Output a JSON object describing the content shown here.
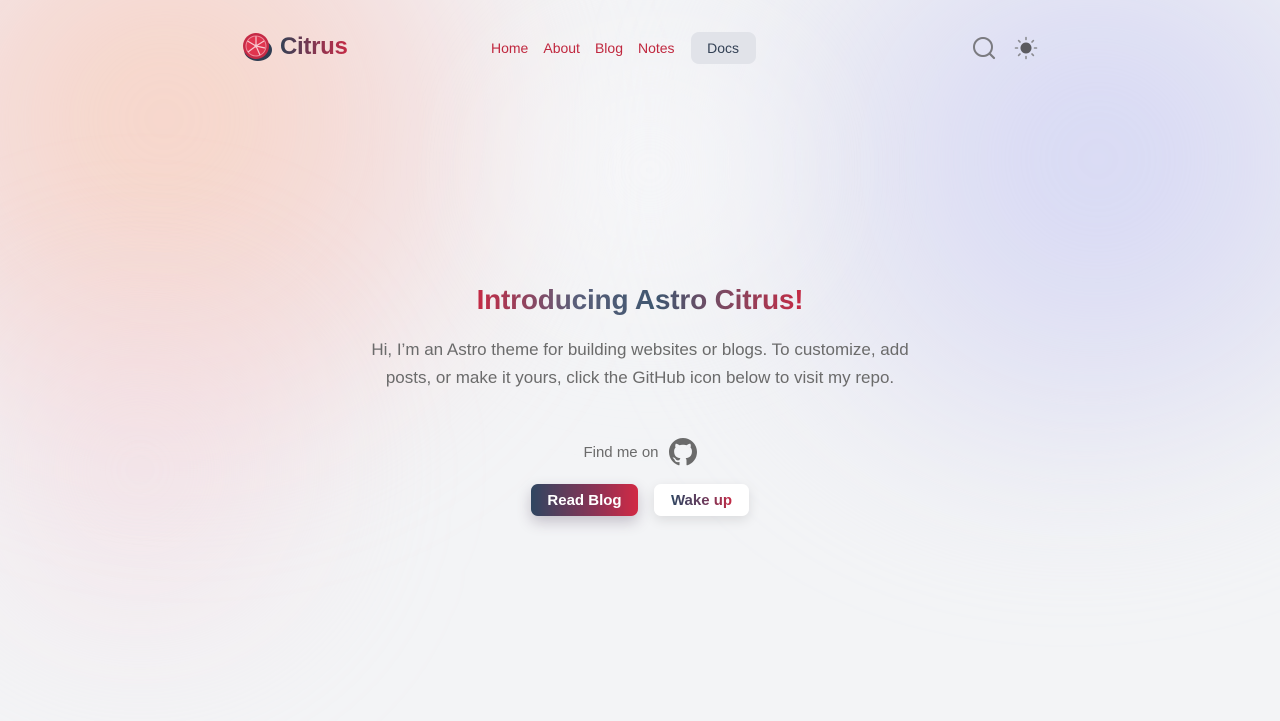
{
  "brand": {
    "name": "Citrus",
    "logo_icon": "citrus-slice-icon"
  },
  "nav": {
    "items": [
      {
        "label": "Home"
      },
      {
        "label": "About"
      },
      {
        "label": "Blog"
      },
      {
        "label": "Notes"
      }
    ],
    "docs_label": "Docs"
  },
  "header_icons": {
    "search": "search-icon",
    "theme": "sun-icon"
  },
  "hero": {
    "title": "Introducing Astro Citrus!",
    "description": "Hi, I’m an Astro theme for building websites or blogs. To customize, add posts, or make it yours, click the GitHub icon below to visit my repo.",
    "find_me_text": "Find me on",
    "social_icon": "github-icon",
    "primary_button": "Read Blog",
    "secondary_button": "Wake up"
  },
  "colors": {
    "accent": "#c0283f",
    "dark": "#334155",
    "text_muted": "#6b6b6b",
    "background": "#f3f4f6"
  }
}
